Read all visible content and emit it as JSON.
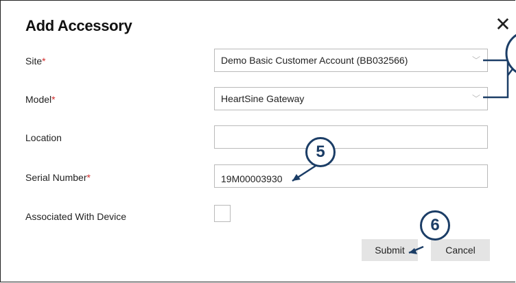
{
  "dialog": {
    "title": "Add Accessory",
    "close_glyph": "✕"
  },
  "form": {
    "site": {
      "label": "Site",
      "required_mark": "*",
      "value": "Demo Basic Customer Account (BB032566)"
    },
    "model": {
      "label": "Model",
      "required_mark": "*",
      "value": "HeartSine Gateway"
    },
    "location": {
      "label": "Location",
      "value": ""
    },
    "serial": {
      "label": "Serial Number",
      "required_mark": "*",
      "value": "19M00003930"
    },
    "associated": {
      "label": "Associated With Device",
      "checked": false
    }
  },
  "buttons": {
    "submit": "Submit",
    "cancel": "Cancel"
  },
  "callouts": {
    "serial_step": "5",
    "submit_step": "6"
  },
  "colors": {
    "accent": "#1b3d66",
    "required": "#d22b2b",
    "button_bg": "#e4e4e4"
  }
}
